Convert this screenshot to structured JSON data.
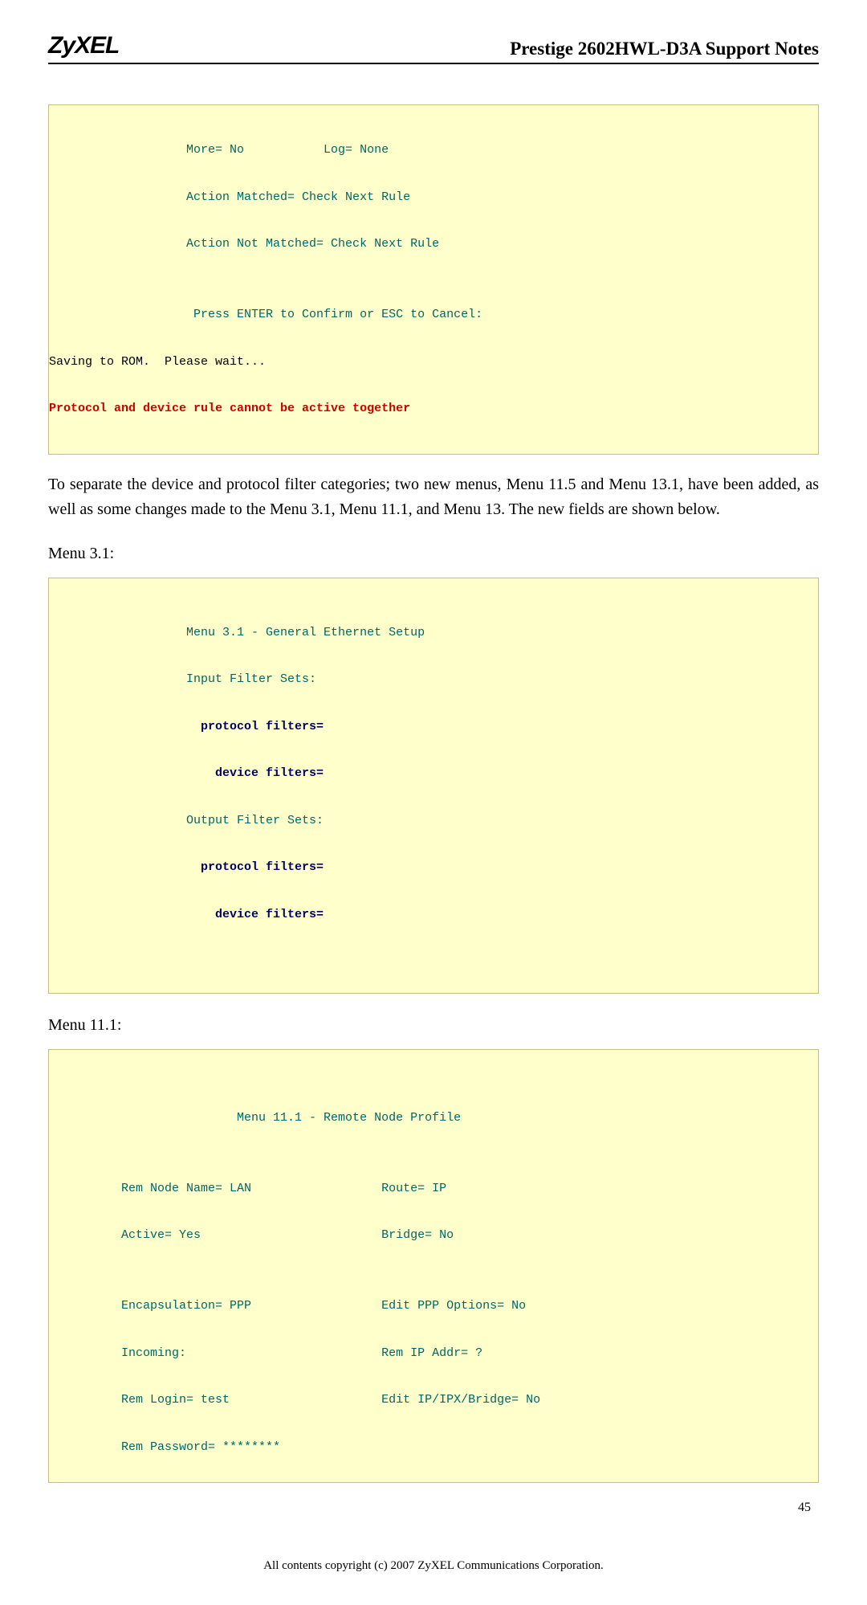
{
  "header": {
    "logo": "ZyXEL",
    "title": "Prestige 2602HWL-D3A Support Notes"
  },
  "box1": {
    "l1": "                   More= No           Log= None",
    "l2": "                   Action Matched= Check Next Rule",
    "l3": "                   Action Not Matched= Check Next Rule",
    "l4": "",
    "l5": "                    Press ENTER to Confirm or ESC to Cancel:",
    "l6": "Saving to ROM.  Please wait...",
    "l7": "Protocol and device rule cannot be active together"
  },
  "para1": "To separate the device and protocol filter categories; two new menus, Menu 11.5 and Menu 13.1, have been added, as well as some changes made to the Menu 3.1, Menu 11.1, and Menu 13. The new fields are shown below.",
  "menu31_label": "Menu 3.1:",
  "box2": {
    "l1": "                   Menu 3.1 - General Ethernet Setup",
    "l2": "                   Input Filter Sets:",
    "l3": "                     protocol filters=",
    "l4": "                       device filters=",
    "l5": "                   Output Filter Sets:",
    "l6": "                     protocol filters=",
    "l7": "                       device filters=",
    "l8": ""
  },
  "menu111_label": "Menu 11.1:",
  "box3": {
    "l0": "",
    "l1": "                          Menu 11.1 - Remote Node Profile",
    "l2": "",
    "l3": "          Rem Node Name= LAN                  Route= IP",
    "l4": "          Active= Yes                         Bridge= No",
    "l5": "",
    "l6": "          Encapsulation= PPP                  Edit PPP Options= No",
    "l7": "          Incoming:                           Rem IP Addr= ?",
    "l8": "          Rem Login= test                     Edit IP/IPX/Bridge= No",
    "l9": "          Rem Password= ********"
  },
  "page_number": "45",
  "footer": "All contents copyright (c) 2007 ZyXEL Communications Corporation."
}
